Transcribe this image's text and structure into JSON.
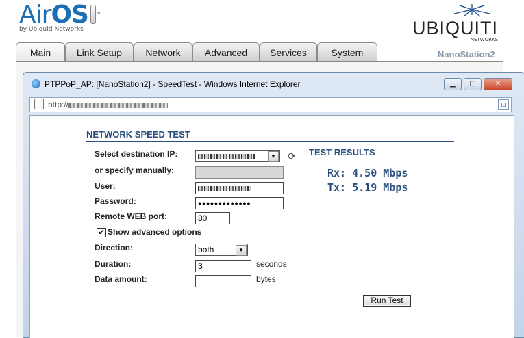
{
  "brand": {
    "product_air": "Air",
    "product_os": "OS",
    "trademark": "™",
    "byline": "by Ubiquiti Networks",
    "vendor": "UBIQUITI",
    "vendor_sub": "NETWORKS",
    "device": "NanoStation2"
  },
  "tabs": [
    {
      "label": "Main",
      "active": true
    },
    {
      "label": "Link Setup",
      "active": false
    },
    {
      "label": "Network",
      "active": false
    },
    {
      "label": "Advanced",
      "active": false
    },
    {
      "label": "Services",
      "active": false
    },
    {
      "label": "System",
      "active": false
    }
  ],
  "window": {
    "title": "PTPPoP_AP: [NanoStation2] - SpeedTest - Windows Internet Explorer",
    "address_prefix": "http://",
    "buttons": {
      "minimize": "▁",
      "maximize": "▢",
      "close": "✕"
    }
  },
  "form": {
    "heading": "NETWORK SPEED TEST",
    "dest_ip_label": "Select destination IP:",
    "manual_label": "or specify manually:",
    "user_label": "User:",
    "password_label": "Password:",
    "password_value": "●●●●●●●●●●●●●",
    "port_label": "Remote WEB port:",
    "port_value": "80",
    "advanced_label": "Show advanced options",
    "advanced_checked": true,
    "direction_label": "Direction:",
    "direction_value": "both",
    "duration_label": "Duration:",
    "duration_value": "3",
    "duration_unit": "seconds",
    "amount_label": "Data amount:",
    "amount_value": "",
    "amount_unit": "bytes",
    "run_button": "Run Test"
  },
  "results": {
    "heading": "TEST RESULTS",
    "rx": "Rx: 4.50 Mbps",
    "tx": "Tx: 5.19 Mbps"
  },
  "colors": {
    "accent": "#2a4f7f",
    "brand_blue": "#1b6fb5"
  }
}
